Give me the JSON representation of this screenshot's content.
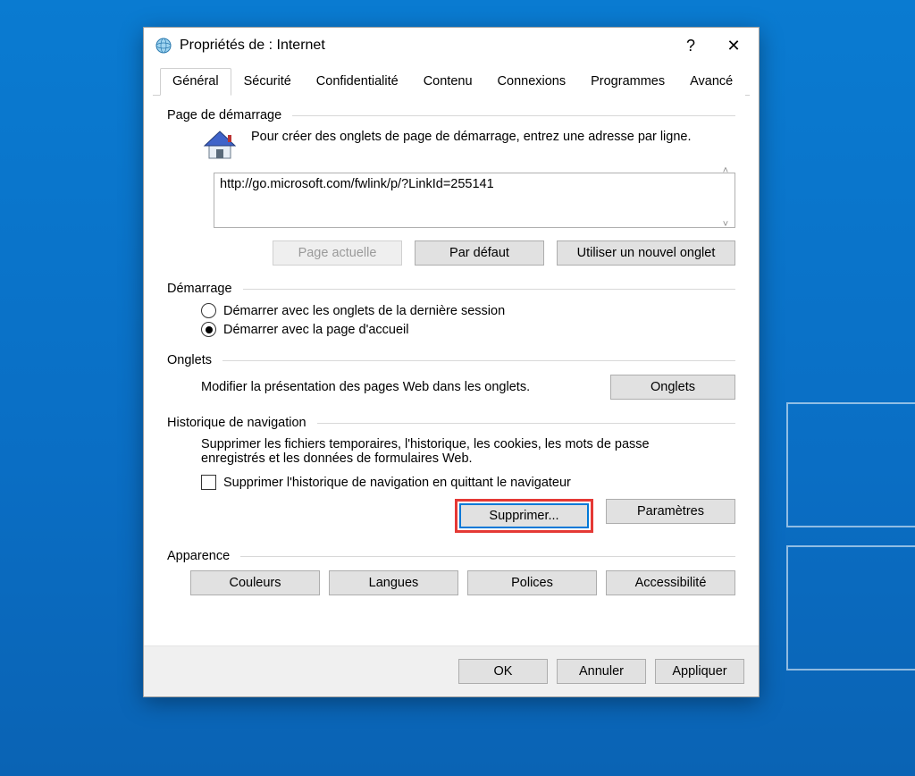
{
  "window": {
    "title": "Propriétés de : Internet",
    "help": "?",
    "close": "✕"
  },
  "tabs": [
    "Général",
    "Sécurité",
    "Confidentialité",
    "Contenu",
    "Connexions",
    "Programmes",
    "Avancé"
  ],
  "activeTabIndex": 0,
  "homepage": {
    "group_label": "Page de démarrage",
    "instruction": "Pour créer des onglets de page de démarrage, entrez une adresse par ligne.",
    "url_value": "http://go.microsoft.com/fwlink/p/?LinkId=255141",
    "buttons": {
      "current": "Page actuelle",
      "default": "Par défaut",
      "newtab": "Utiliser un nouvel onglet"
    }
  },
  "startup": {
    "group_label": "Démarrage",
    "option_last_session": "Démarrer avec les onglets de la dernière session",
    "option_home": "Démarrer avec la page d'accueil",
    "selected": "home"
  },
  "tabs_section": {
    "group_label": "Onglets",
    "text": "Modifier la présentation des pages Web dans les onglets.",
    "button": "Onglets"
  },
  "history": {
    "group_label": "Historique de navigation",
    "text": "Supprimer les fichiers temporaires, l'historique, les cookies, les mots de passe enregistrés et les données de formulaires Web.",
    "checkbox_label": "Supprimer l'historique de navigation en quittant le navigateur",
    "checkbox_checked": false,
    "delete_button": "Supprimer...",
    "settings_button": "Paramètres"
  },
  "appearance": {
    "group_label": "Apparence",
    "buttons": [
      "Couleurs",
      "Langues",
      "Polices",
      "Accessibilité"
    ]
  },
  "footer": {
    "ok": "OK",
    "cancel": "Annuler",
    "apply": "Appliquer"
  }
}
